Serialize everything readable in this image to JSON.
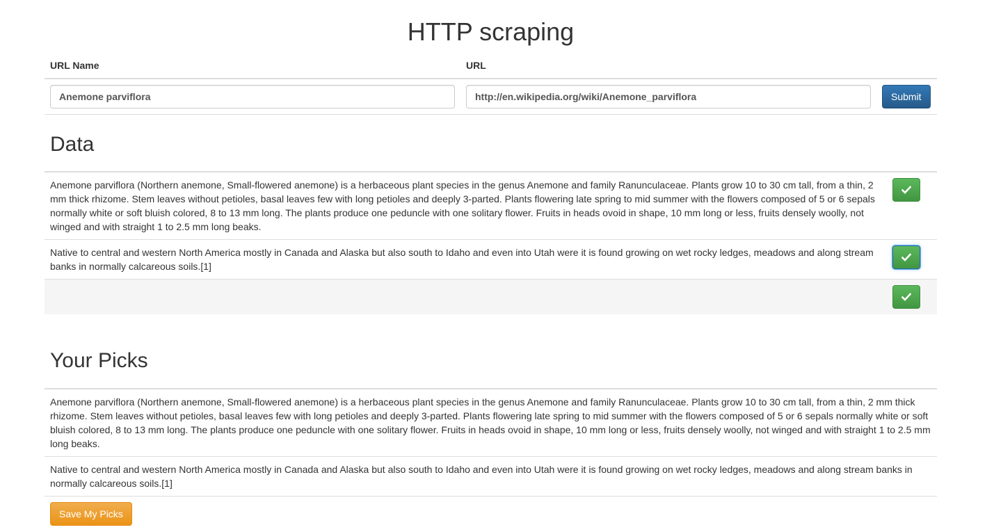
{
  "page": {
    "title": "HTTP scraping"
  },
  "form": {
    "url_name_header": "URL Name",
    "url_header": "URL",
    "url_name_value": "Anemone parviflora",
    "url_value": "http://en.wikipedia.org/wiki/Anemone_parviflora",
    "submit_label": "Submit"
  },
  "data_section": {
    "heading": "Data",
    "rows": [
      {
        "text": "Anemone parviflora (Northern anemone, Small-flowered anemone) is a herbaceous plant species in the genus Anemone and family Ranunculaceae. Plants grow 10 to 30 cm tall, from a thin, 2 mm thick rhizome. Stem leaves without petioles, basal leaves few with long petioles and deeply 3-parted. Plants flowering late spring to mid summer with the flowers composed of 5 or 6 sepals normally white or soft bluish colored, 8 to 13 mm long. The plants produce one peduncle with one solitary flower. Fruits in heads ovoid in shape, 10 mm long or less, fruits densely woolly, not winged and with straight 1 to 2.5 mm long beaks."
      },
      {
        "text": "Native to central and western North America mostly in Canada and Alaska but also south to Idaho and even into Utah were it is found growing on wet rocky ledges, meadows and along stream banks in normally calcareous soils.[1]"
      },
      {
        "text": ""
      }
    ],
    "pick_icon": "check-icon"
  },
  "picks_section": {
    "heading": "Your Picks",
    "rows": [
      {
        "text": "Anemone parviflora (Northern anemone, Small-flowered anemone) is a herbaceous plant species in the genus Anemone and family Ranunculaceae. Plants grow 10 to 30 cm tall, from a thin, 2 mm thick rhizome. Stem leaves without petioles, basal leaves few with long petioles and deeply 3-parted. Plants flowering late spring to mid summer with the flowers composed of 5 or 6 sepals normally white or soft bluish colored, 8 to 13 mm long. The plants produce one peduncle with one solitary flower. Fruits in heads ovoid in shape, 10 mm long or less, fruits densely woolly, not winged and with straight 1 to 2.5 mm long beaks."
      },
      {
        "text": "Native to central and western North America mostly in Canada and Alaska but also south to Idaho and even into Utah were it is found growing on wet rocky ledges, meadows and along stream banks in normally calcareous soils.[1]"
      }
    ],
    "save_label": "Save My Picks"
  },
  "colors": {
    "primary": "#337ab7",
    "success": "#5cb85c",
    "warning": "#f0ad4e",
    "border": "#dddddd",
    "stripe": "#f5f5f5"
  }
}
